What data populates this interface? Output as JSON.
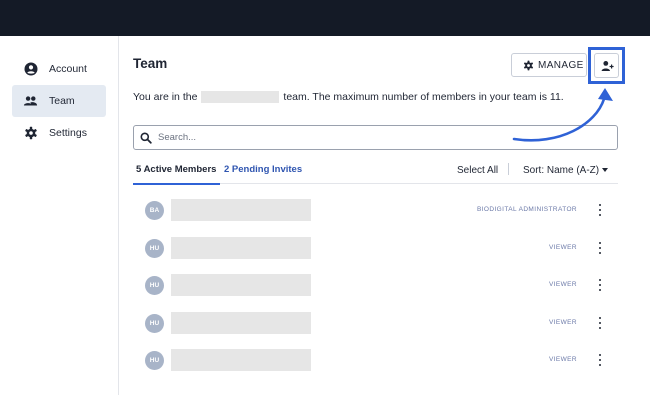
{
  "sidebar": {
    "items": [
      {
        "label": "Account",
        "icon": "account-circle-icon"
      },
      {
        "label": "Team",
        "icon": "group-icon",
        "active": true
      },
      {
        "label": "Settings",
        "icon": "gear-icon"
      }
    ]
  },
  "main": {
    "title": "Team",
    "manage_label": "MANAGE",
    "info_prefix": "You are in the",
    "info_suffix": "team. The maximum number of members in your team is 11."
  },
  "search": {
    "placeholder": "Search..."
  },
  "tabs": {
    "active_members": "5 Active Members",
    "pending_invites": "2 Pending Invites"
  },
  "list_controls": {
    "select_all": "Select All",
    "sort": "Sort: Name (A-Z)"
  },
  "members": [
    {
      "initials": "BA",
      "role": "BIODIGITAL ADMINISTRATOR"
    },
    {
      "initials": "HU",
      "role": "VIEWER"
    },
    {
      "initials": "HU",
      "role": "VIEWER"
    },
    {
      "initials": "HU",
      "role": "VIEWER"
    },
    {
      "initials": "HU",
      "role": "VIEWER"
    }
  ],
  "colors": {
    "topbar": "#141a26",
    "accent": "#2f62d6",
    "avatar": "#a8b4c8",
    "role_text": "#6c7aa8"
  }
}
